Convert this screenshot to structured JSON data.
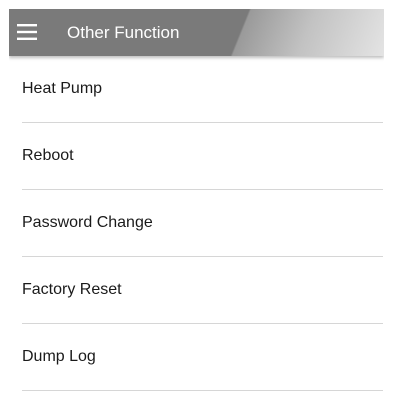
{
  "app_bar": {
    "title": "Other Function",
    "menu_icon": "hamburger-menu-icon"
  },
  "colors": {
    "app_bar": "#7a7a7a",
    "app_bar_text": "#ffffff",
    "item_text": "#1a1a1a",
    "divider": "#d6d6d6",
    "background": "#ffffff"
  },
  "menu": {
    "items": [
      {
        "label": "Heat Pump"
      },
      {
        "label": "Reboot"
      },
      {
        "label": "Password Change"
      },
      {
        "label": "Factory Reset"
      },
      {
        "label": "Dump Log"
      }
    ]
  }
}
